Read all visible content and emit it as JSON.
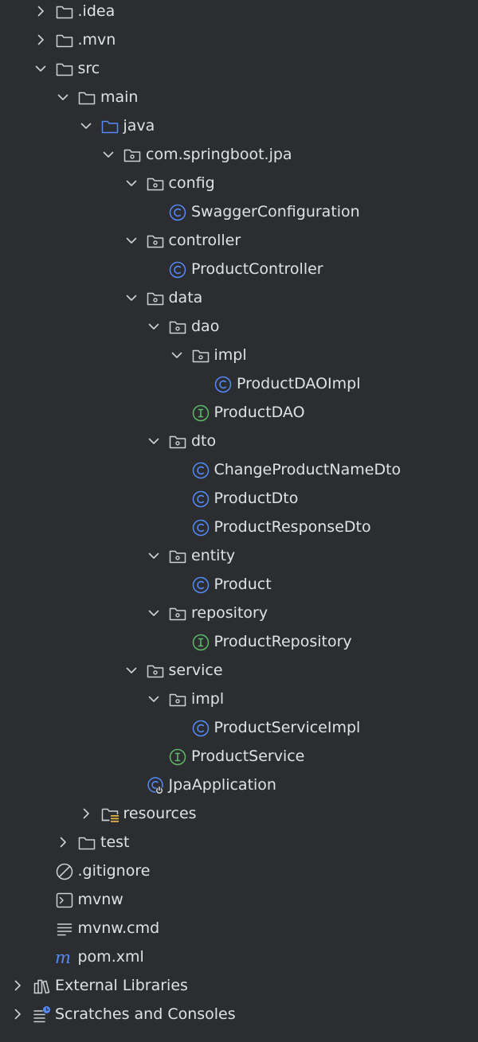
{
  "colors": {
    "background": "#2b2d30",
    "text": "#dfe1e5",
    "chevron": "#cfd1d6",
    "folder": "#ced0d6",
    "source_folder": "#548af7",
    "class_icon": "#548af7",
    "interface_icon": "#5fb865"
  },
  "tree": [
    {
      "label": ".idea",
      "icon": "folder-icon",
      "depth": 1,
      "chevron": "collapsed"
    },
    {
      "label": ".mvn",
      "icon": "folder-icon",
      "depth": 1,
      "chevron": "collapsed"
    },
    {
      "label": "src",
      "icon": "folder-icon",
      "depth": 1,
      "chevron": "expanded"
    },
    {
      "label": "main",
      "icon": "folder-icon",
      "depth": 2,
      "chevron": "expanded"
    },
    {
      "label": "java",
      "icon": "source-folder-icon",
      "depth": 3,
      "chevron": "expanded"
    },
    {
      "label": "com.springboot.jpa",
      "icon": "package-icon",
      "depth": 4,
      "chevron": "expanded"
    },
    {
      "label": "config",
      "icon": "package-icon",
      "depth": 5,
      "chevron": "expanded"
    },
    {
      "label": "SwaggerConfiguration",
      "icon": "class-icon",
      "depth": 6,
      "chevron": "none"
    },
    {
      "label": "controller",
      "icon": "package-icon",
      "depth": 5,
      "chevron": "expanded"
    },
    {
      "label": "ProductController",
      "icon": "class-icon",
      "depth": 6,
      "chevron": "none"
    },
    {
      "label": "data",
      "icon": "package-icon",
      "depth": 5,
      "chevron": "expanded"
    },
    {
      "label": "dao",
      "icon": "package-icon",
      "depth": 6,
      "chevron": "expanded"
    },
    {
      "label": "impl",
      "icon": "package-icon",
      "depth": 7,
      "chevron": "expanded"
    },
    {
      "label": "ProductDAOImpl",
      "icon": "class-icon",
      "depth": 8,
      "chevron": "none"
    },
    {
      "label": "ProductDAO",
      "icon": "interface-icon",
      "depth": 7,
      "chevron": "none"
    },
    {
      "label": "dto",
      "icon": "package-icon",
      "depth": 6,
      "chevron": "expanded"
    },
    {
      "label": "ChangeProductNameDto",
      "icon": "class-icon",
      "depth": 7,
      "chevron": "none"
    },
    {
      "label": "ProductDto",
      "icon": "class-icon",
      "depth": 7,
      "chevron": "none"
    },
    {
      "label": "ProductResponseDto",
      "icon": "class-icon",
      "depth": 7,
      "chevron": "none"
    },
    {
      "label": "entity",
      "icon": "package-icon",
      "depth": 6,
      "chevron": "expanded"
    },
    {
      "label": "Product",
      "icon": "class-icon",
      "depth": 7,
      "chevron": "none"
    },
    {
      "label": "repository",
      "icon": "package-icon",
      "depth": 6,
      "chevron": "expanded"
    },
    {
      "label": "ProductRepository",
      "icon": "interface-icon",
      "depth": 7,
      "chevron": "none"
    },
    {
      "label": "service",
      "icon": "package-icon",
      "depth": 5,
      "chevron": "expanded"
    },
    {
      "label": "impl",
      "icon": "package-icon",
      "depth": 6,
      "chevron": "expanded"
    },
    {
      "label": "ProductServiceImpl",
      "icon": "class-icon",
      "depth": 7,
      "chevron": "none"
    },
    {
      "label": "ProductService",
      "icon": "interface-icon",
      "depth": 6,
      "chevron": "none"
    },
    {
      "label": "JpaApplication",
      "icon": "spring-boot-class-icon",
      "depth": 5,
      "chevron": "none"
    },
    {
      "label": "resources",
      "icon": "resources-folder-icon",
      "depth": 3,
      "chevron": "collapsed"
    },
    {
      "label": "test",
      "icon": "folder-icon",
      "depth": 2,
      "chevron": "collapsed"
    },
    {
      "label": ".gitignore",
      "icon": "ignored-file-icon",
      "depth": 1,
      "chevron": "none"
    },
    {
      "label": "mvnw",
      "icon": "terminal-file-icon",
      "depth": 1,
      "chevron": "none"
    },
    {
      "label": "mvnw.cmd",
      "icon": "text-file-icon",
      "depth": 1,
      "chevron": "none"
    },
    {
      "label": "pom.xml",
      "icon": "maven-icon",
      "depth": 1,
      "chevron": "none"
    },
    {
      "label": "External Libraries",
      "icon": "libraries-icon",
      "depth": 0,
      "chevron": "collapsed"
    },
    {
      "label": "Scratches and Consoles",
      "icon": "scratches-icon",
      "depth": 0,
      "chevron": "collapsed"
    }
  ]
}
